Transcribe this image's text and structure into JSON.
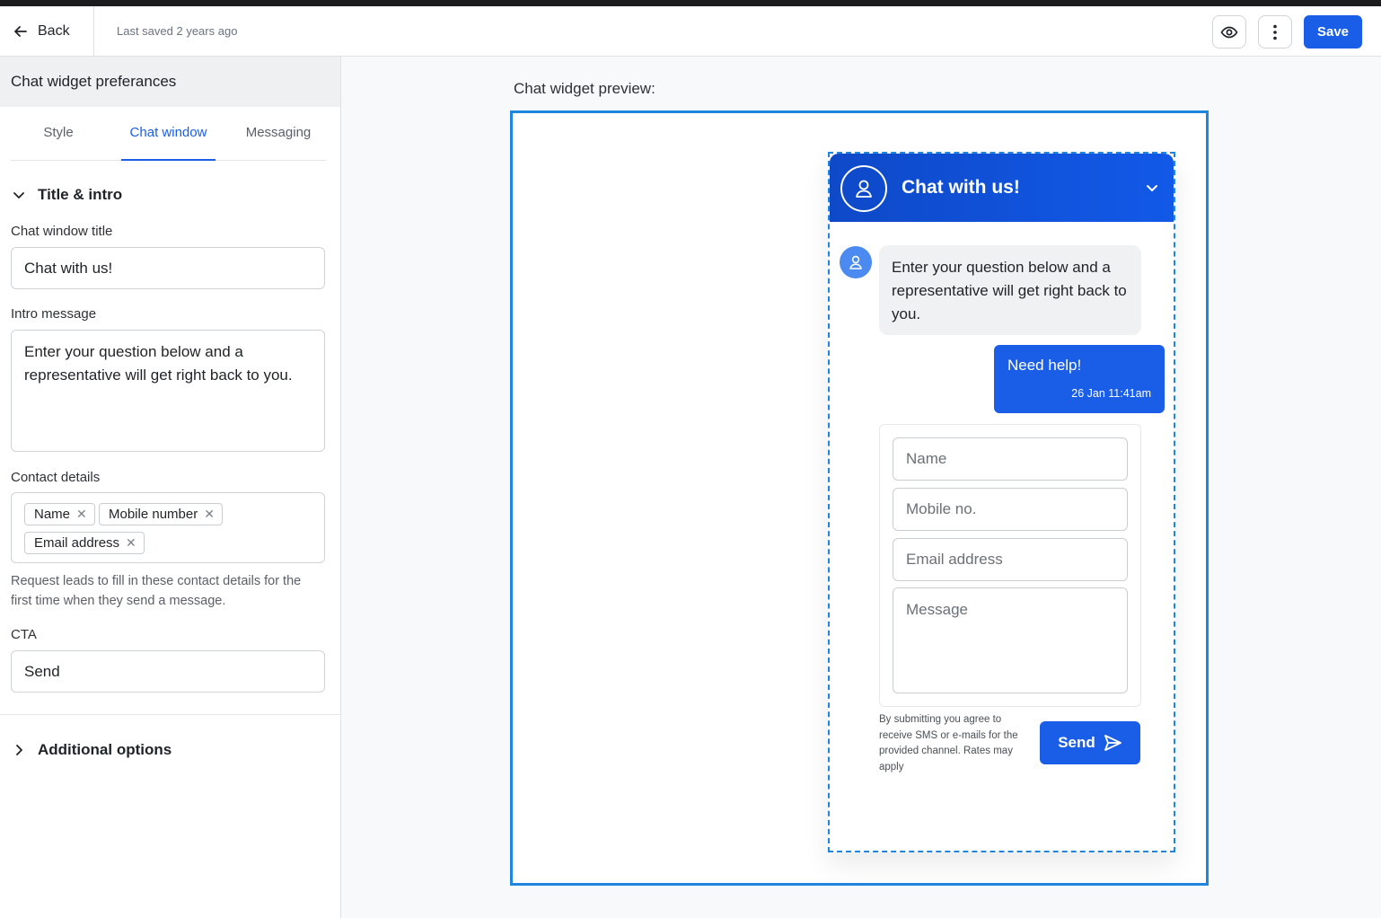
{
  "topbar": {
    "back_label": "Back",
    "saved_text": "Last saved 2 years ago",
    "preview_icon": "eye-icon",
    "more_icon": "more-vertical-icon",
    "save_label": "Save"
  },
  "sidebar": {
    "title": "Chat widget preferances",
    "tabs": [
      {
        "label": "Style",
        "active": false
      },
      {
        "label": "Chat window",
        "active": true
      },
      {
        "label": "Messaging",
        "active": false
      }
    ],
    "section_title": "Title & intro",
    "fields": {
      "chat_window_title_label": "Chat window title",
      "chat_window_title_value": "Chat with us!",
      "intro_message_label": "Intro message",
      "intro_message_value": "Enter your question below and a representative will get right back to you.",
      "contact_details_label": "Contact details",
      "contact_chips": [
        "Name",
        "Mobile number",
        "Email address"
      ],
      "contact_helper": "Request leads to fill in these contact details for the first time when they send a message.",
      "cta_label": "CTA",
      "cta_value": "Send"
    },
    "additional_options": "Additional options"
  },
  "preview": {
    "label": "Chat widget preview:",
    "widget": {
      "header_title": "Chat with us!",
      "intro_bubble": "Enter your question below and a representative will get right back to you.",
      "user_message": "Need help!",
      "user_message_time": "26 Jan 11:41am",
      "form": {
        "name_placeholder": "Name",
        "mobile_placeholder": "Mobile no.",
        "email_placeholder": "Email address",
        "message_placeholder": "Message"
      },
      "disclaimer": "By submitting you agree to receive SMS or e-mails for the provided channel. Rates may apply",
      "send_label": "Send"
    }
  },
  "colors": {
    "accent": "#1a5ee8",
    "header_gradient_start": "#0e49c8",
    "preview_frame_border": "#1f86e0"
  }
}
